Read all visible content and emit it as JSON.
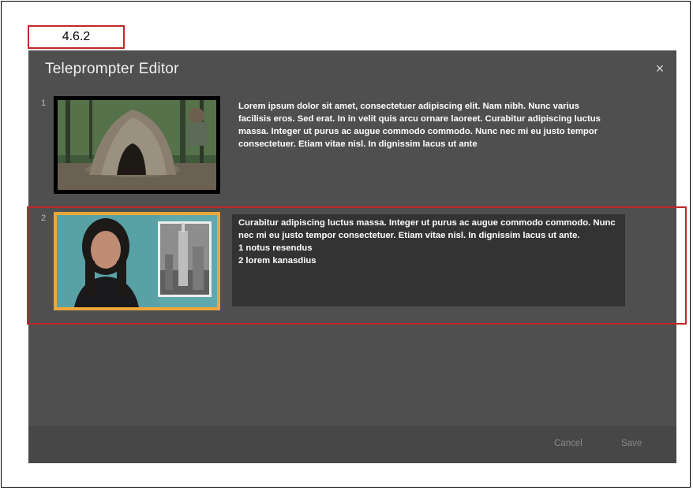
{
  "annotation": {
    "version_label": "4.6.2"
  },
  "dialog": {
    "title": "Teleprompter Editor",
    "close_icon": "close-icon",
    "close_glyph": "×"
  },
  "rows": [
    {
      "number": "1",
      "thumbnail": "hut-forest-thumbnail",
      "selected": false,
      "text": "Lorem ipsum dolor sit amet, consectetuer adipiscing elit. Nam nibh. Nunc varius facilisis eros. Sed erat. In in velit quis arcu ornare laoreet. Curabitur adipiscing luctus massa. Integer ut purus ac augue commodo commodo. Nunc nec mi eu justo tempor consectetuer. Etiam vitae nisl. In dignissim lacus ut ante"
    },
    {
      "number": "2",
      "thumbnail": "woman-city-thumbnail",
      "selected": true,
      "lines": [
        "Curabitur adipiscing luctus massa. Integer ut purus ac augue commodo commodo. Nunc nec mi eu justo tempor consectetuer. Etiam vitae nisl. In dignissim lacus ut ante.",
        "1 notus resendus",
        "2 lorem kanasdius"
      ]
    }
  ],
  "footer": {
    "cancel_label": "Cancel",
    "save_label": "Save"
  },
  "colors": {
    "dialog_bg": "#4f4f4f",
    "editor_bg": "#333333",
    "selected_border": "#f0a63a",
    "annotation_red": "#c0282b"
  }
}
